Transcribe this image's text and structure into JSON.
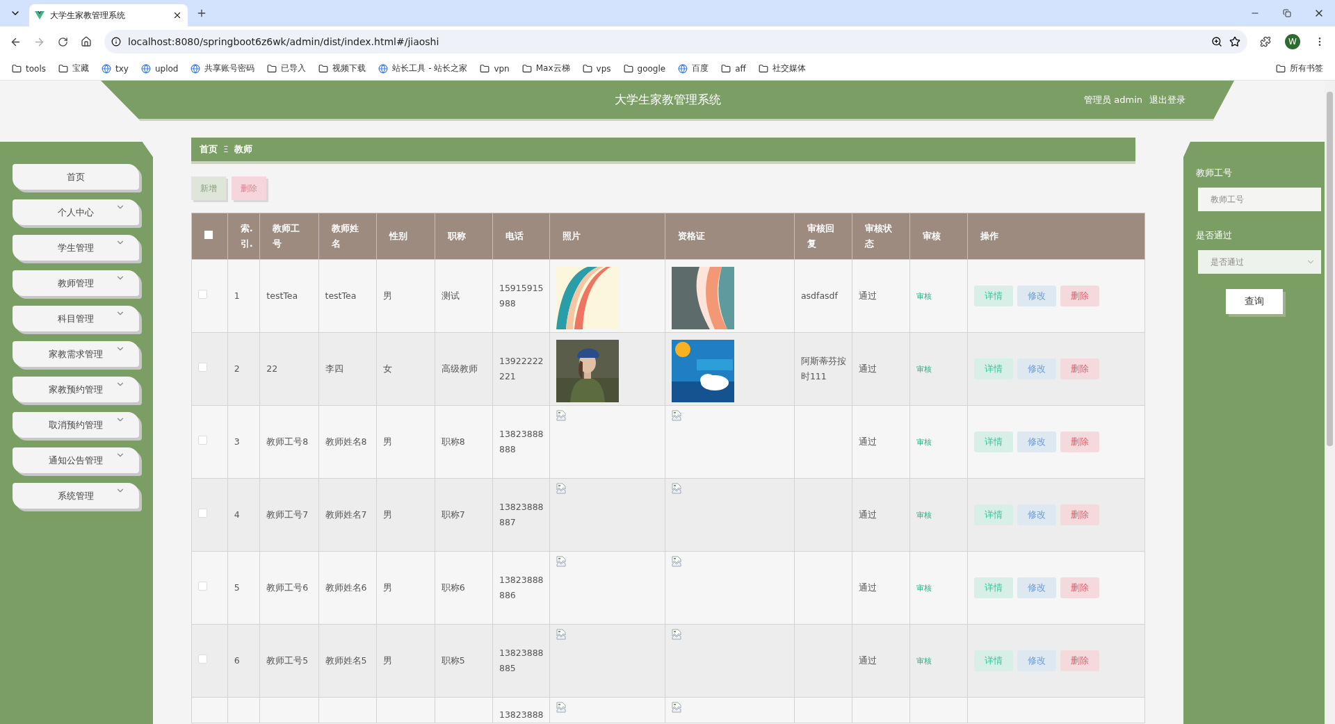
{
  "browser": {
    "tab_title": "大学生家教管理系统",
    "url": "localhost:8080/springboot6z6wk/admin/dist/index.html#/jiaoshi",
    "profile": "W",
    "all_bookmarks": "所有书签",
    "bookmarks": [
      {
        "label": "tools",
        "kind": "folder"
      },
      {
        "label": "宝藏",
        "kind": "folder"
      },
      {
        "label": "txy",
        "kind": "site"
      },
      {
        "label": "uplod",
        "kind": "site"
      },
      {
        "label": "共享账号密码",
        "kind": "site"
      },
      {
        "label": "已导入",
        "kind": "folder"
      },
      {
        "label": "视频下载",
        "kind": "folder"
      },
      {
        "label": "站长工具 - 站长之家",
        "kind": "site"
      },
      {
        "label": "vpn",
        "kind": "folder"
      },
      {
        "label": "Max云梯",
        "kind": "folder"
      },
      {
        "label": "vps",
        "kind": "folder"
      },
      {
        "label": "google",
        "kind": "folder"
      },
      {
        "label": "百度",
        "kind": "site"
      },
      {
        "label": "aff",
        "kind": "folder"
      },
      {
        "label": "社交媒体",
        "kind": "folder"
      }
    ]
  },
  "header": {
    "title": "大学生家教管理系统",
    "user": "管理员 admin",
    "logout": "退出登录"
  },
  "sidebar": {
    "items": [
      {
        "label": "首页",
        "expandable": false
      },
      {
        "label": "个人中心",
        "expandable": true
      },
      {
        "label": "学生管理",
        "expandable": true
      },
      {
        "label": "教师管理",
        "expandable": true
      },
      {
        "label": "科目管理",
        "expandable": true
      },
      {
        "label": "家教需求管理",
        "expandable": true
      },
      {
        "label": "家教预约管理",
        "expandable": true
      },
      {
        "label": "取消预约管理",
        "expandable": true
      },
      {
        "label": "通知公告管理",
        "expandable": true
      },
      {
        "label": "系统管理",
        "expandable": true
      }
    ]
  },
  "breadcrumb": {
    "home": "首页",
    "separator": "Ξ",
    "current": "教师"
  },
  "toolbar": [
    {
      "kind": "add",
      "label": "新增"
    },
    {
      "kind": "delete",
      "label": "删除"
    }
  ],
  "table": {
    "select_all": {
      "checked": false
    },
    "columns": [
      "索.引.",
      "教师工号",
      "教师姓名",
      "性别",
      "职称",
      "电话",
      "照片",
      "资格证",
      "审核回复",
      "审核状态",
      "审核",
      "操作"
    ],
    "rows": [
      {
        "checked": false,
        "index": "1",
        "teacher_id": "testTea",
        "name": "testTea",
        "gender": "男",
        "title": "测试",
        "phone": "15915915988",
        "reply": "asdfasdf",
        "status": "通过",
        "review": "审核",
        "actions": [
          {
            "kind": "detail",
            "label": "详情"
          },
          {
            "kind": "edit",
            "label": "修改"
          },
          {
            "kind": "delete",
            "label": "删除"
          }
        ]
      },
      {
        "checked": false,
        "index": "2",
        "teacher_id": "22",
        "name": "李四",
        "gender": "女",
        "title": "高级教师",
        "phone": "13922222221",
        "reply": "阿斯蒂芬按时111",
        "status": "通过",
        "review": "审核",
        "actions": [
          {
            "kind": "detail",
            "label": "详情"
          },
          {
            "kind": "edit",
            "label": "修改"
          },
          {
            "kind": "delete",
            "label": "删除"
          }
        ]
      },
      {
        "checked": false,
        "index": "3",
        "teacher_id": "教师工号8",
        "name": "教师姓名8",
        "gender": "男",
        "title": "职称8",
        "phone": "13823888888",
        "photo": {
          "kind": "broken"
        },
        "certificate": {
          "kind": "broken"
        },
        "status": "通过",
        "review": "审核",
        "actions": [
          {
            "kind": "detail",
            "label": "详情"
          },
          {
            "kind": "edit",
            "label": "修改"
          },
          {
            "kind": "delete",
            "label": "删除"
          }
        ]
      },
      {
        "checked": false,
        "index": "4",
        "teacher_id": "教师工号7",
        "name": "教师姓名7",
        "gender": "男",
        "title": "职称7",
        "phone": "13823888887",
        "photo": {
          "kind": "broken"
        },
        "certificate": {
          "kind": "broken"
        },
        "status": "通过",
        "review": "审核",
        "actions": [
          {
            "kind": "detail",
            "label": "详情"
          },
          {
            "kind": "edit",
            "label": "修改"
          },
          {
            "kind": "delete",
            "label": "删除"
          }
        ]
      },
      {
        "checked": false,
        "index": "5",
        "teacher_id": "教师工号6",
        "name": "教师姓名6",
        "gender": "男",
        "title": "职称6",
        "phone": "13823888886",
        "photo": {
          "kind": "broken"
        },
        "certificate": {
          "kind": "broken"
        },
        "status": "通过",
        "review": "审核",
        "actions": [
          {
            "kind": "detail",
            "label": "详情"
          },
          {
            "kind": "edit",
            "label": "修改"
          },
          {
            "kind": "delete",
            "label": "删除"
          }
        ]
      },
      {
        "checked": false,
        "index": "6",
        "teacher_id": "教师工号5",
        "name": "教师姓名5",
        "gender": "男",
        "title": "职称5",
        "phone": "13823888885",
        "photo": {
          "kind": "broken"
        },
        "certificate": {
          "kind": "broken"
        },
        "status": "通过",
        "review": "审核",
        "actions": [
          {
            "kind": "detail",
            "label": "详情"
          },
          {
            "kind": "edit",
            "label": "修改"
          },
          {
            "kind": "delete",
            "label": "删除"
          }
        ]
      },
      {
        "partial": true,
        "phone": "13823888",
        "photo": {
          "kind": "broken"
        },
        "certificate": {
          "kind": "broken"
        }
      }
    ]
  },
  "search_panel": {
    "fields": [
      {
        "kind": "input",
        "label": "教师工号",
        "placeholder": "教师工号"
      },
      {
        "kind": "select",
        "label": "是否通过",
        "placeholder": "是否通过"
      }
    ],
    "button": "查询"
  }
}
